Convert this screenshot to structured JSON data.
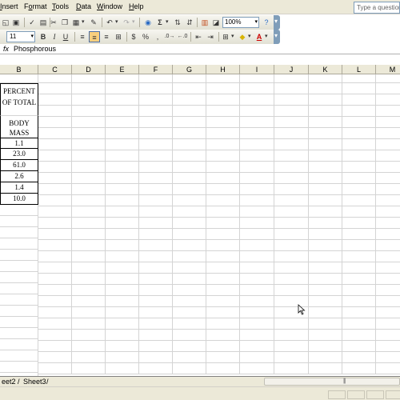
{
  "menu": {
    "insert": {
      "u": "I",
      "rest": "nsert"
    },
    "format": {
      "pre": "F",
      "u": "o",
      "rest": "rmat"
    },
    "tools": {
      "u": "T",
      "rest": "ools"
    },
    "data": {
      "u": "D",
      "rest": "ata"
    },
    "window": {
      "u": "W",
      "rest": "indow"
    },
    "help": {
      "u": "H",
      "rest": "elp"
    },
    "help_search": "Type a question for help"
  },
  "toolbar": {
    "zoom": "100%",
    "font_size": "11",
    "bold": "B",
    "italic": "I",
    "underline": "U",
    "currency": "$",
    "percent": "%",
    "sigma": "Σ",
    "font_color_letter": "A",
    "help_glyph": "?"
  },
  "formula_bar": {
    "fx": "fx",
    "content": "Phosphorous"
  },
  "columns": [
    "B",
    "C",
    "D",
    "E",
    "F",
    "G",
    "H",
    "I",
    "J",
    "K",
    "L",
    "M"
  ],
  "cells": {
    "b_header_1": "PERCENT",
    "b_header_2": "OF TOTAL",
    "b_header_3": "BODY",
    "b_header_4": "MASS",
    "values": [
      "1.1",
      "23.0",
      "61.0",
      "2.6",
      "1.4",
      "10.0"
    ]
  },
  "sheets": {
    "sheet2": "eet2",
    "sheet3": "Sheet3"
  },
  "colors": {
    "chrome": "#ece9d8",
    "toolbar_accent": "#7f9db9",
    "pressed": "#f8cf7e",
    "gridline": "#d4d4d4"
  }
}
